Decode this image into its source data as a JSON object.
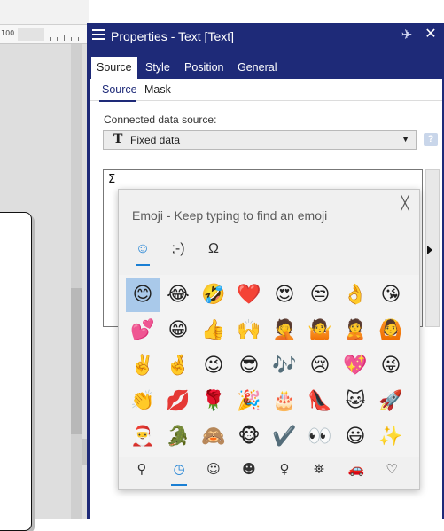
{
  "ruler": {
    "label": "100"
  },
  "panel": {
    "title": "Properties - Text [Text]",
    "tabs": [
      "Source",
      "Style",
      "Position",
      "General"
    ],
    "subtabs": [
      "Source",
      "Mask"
    ],
    "connected_label": "Connected data source:",
    "select_value": "Fixed data",
    "select_icon": "T",
    "text_value": "Σ",
    "help_glyph": "?"
  },
  "icons": {
    "menu": "hamburger-icon",
    "pin": "pin-icon",
    "close": "close-icon",
    "select_type": "text-type-icon",
    "dropdown": "chevron-down-icon",
    "help": "help-icon",
    "expand": "arrow-right-icon"
  },
  "glyphs": {
    "pin": "✈",
    "close": "✕",
    "dropdown": "▼",
    "emoji_close": "╳"
  },
  "emoji_panel": {
    "title": "Emoji - Keep typing to find an emoji",
    "category_tabs": [
      "☺",
      ";-)",
      "Ω"
    ],
    "rows": [
      [
        "😊",
        "😂",
        "🤣",
        "❤️",
        "😍",
        "😒",
        "👌",
        "😘"
      ],
      [
        "💕",
        "😁",
        "👍",
        "🙌",
        "🤦",
        "🤷",
        "🙎",
        "🙆"
      ],
      [
        "✌️",
        "🤞",
        "😉",
        "😎",
        "🎶",
        "😢",
        "💖",
        "😜"
      ],
      [
        "👏",
        "💋",
        "🌹",
        "🎉",
        "🎂",
        "👠",
        "🐱",
        "🚀"
      ],
      [
        "🎅",
        "🐊",
        "🙈",
        "🐵",
        "✔️",
        "👀",
        "😃",
        "✨"
      ]
    ],
    "selected_cell": [
      0,
      0
    ],
    "footer_icons": [
      "⚲",
      "◷",
      "☺",
      "☻",
      "♀",
      "⛯",
      "🚗",
      "♡"
    ]
  },
  "colors": {
    "panel_blue": "#1e2a78",
    "accent": "#1a7fd4",
    "selected": "#a9c9ea"
  }
}
